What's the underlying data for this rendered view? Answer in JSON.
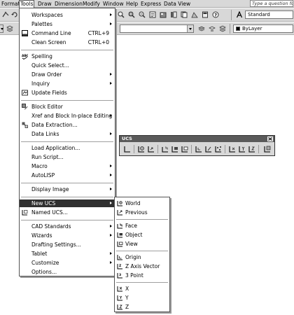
{
  "menubar": {
    "items": [
      "Format",
      "Tools",
      "Draw",
      "Dimension",
      "Modify",
      "Window",
      "Help",
      "Express",
      "Data View"
    ],
    "help_placeholder": "Type a question for"
  },
  "toolbar": {
    "text_style": "Standard",
    "layer": "ByLayer"
  },
  "tools_menu": {
    "items": [
      {
        "label": "Workspaces",
        "submenu": true
      },
      {
        "label": "Palettes",
        "submenu": true
      },
      {
        "label": "Command Line",
        "shortcut": "CTRL+9",
        "icon": "command-line-icon"
      },
      {
        "label": "Clean Screen",
        "shortcut": "CTRL+0"
      },
      {
        "label": "Spelling",
        "icon": "spelling-icon"
      },
      {
        "label": "Quick Select..."
      },
      {
        "label": "Draw Order",
        "submenu": true
      },
      {
        "label": "Inquiry",
        "submenu": true
      },
      {
        "label": "Update Fields",
        "icon": "update-fields-icon"
      },
      {
        "label": "Block Editor",
        "icon": "block-editor-icon"
      },
      {
        "label": "Xref and Block In-place Editing",
        "submenu": true
      },
      {
        "label": "Data Extraction...",
        "icon": "data-extraction-icon"
      },
      {
        "label": "Data Links",
        "submenu": true
      },
      {
        "label": "Load Application..."
      },
      {
        "label": "Run Script..."
      },
      {
        "label": "Macro",
        "submenu": true
      },
      {
        "label": "AutoLISP",
        "submenu": true
      },
      {
        "label": "Display Image",
        "submenu": true
      },
      {
        "label": "New UCS",
        "submenu": true,
        "highlighted": true
      },
      {
        "label": "Named UCS...",
        "icon": "named-ucs-icon"
      },
      {
        "label": "CAD Standards",
        "submenu": true
      },
      {
        "label": "Wizards",
        "submenu": true
      },
      {
        "label": "Drafting Settings..."
      },
      {
        "label": "Tablet",
        "submenu": true
      },
      {
        "label": "Customize",
        "submenu": true
      },
      {
        "label": "Options..."
      }
    ]
  },
  "new_ucs_submenu": {
    "items": [
      "World",
      "Previous",
      "Face",
      "Object",
      "View",
      "Origin",
      "Z Axis Vector",
      "3 Point",
      "X",
      "Y",
      "Z"
    ]
  },
  "ucs_toolbar": {
    "title": "UCS"
  }
}
